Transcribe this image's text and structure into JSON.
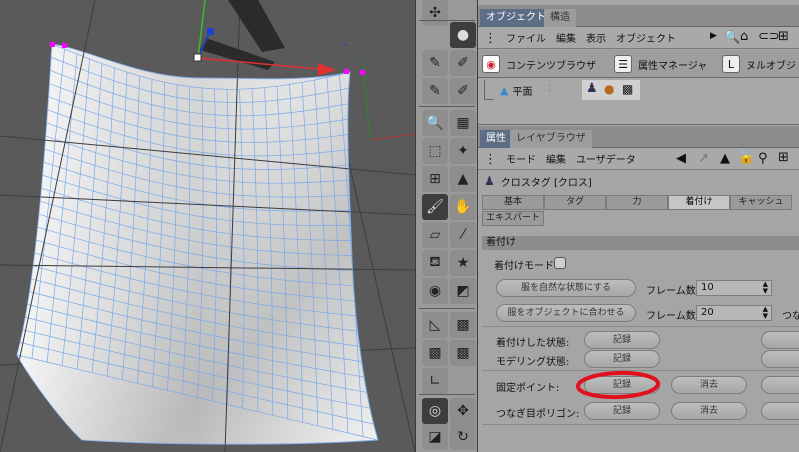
{
  "object_manager": {
    "tabs": [
      "オブジェクト",
      "構造"
    ],
    "menus": [
      "ファイル",
      "編集",
      "表示",
      "オブジェクト"
    ],
    "browser_items": [
      "コンテンツブラウザ",
      "属性マネージャ",
      "ヌルオブジ"
    ],
    "object_name": "平面"
  },
  "attribute_manager": {
    "tabs": [
      "属性",
      "レイヤブラウザ"
    ],
    "menus": [
      "モード",
      "編集",
      "ユーザデータ"
    ],
    "tag_title": "クロスタグ [クロス]",
    "subtabs_row1": [
      "基本",
      "タグ",
      "力",
      "着付け",
      "キャッシュ"
    ],
    "subtabs_row2": [
      "エキスパート"
    ],
    "active_subtab": "着付け",
    "section_title": "着付け",
    "dress_mode_label": "着付けモード",
    "relax_button": "服を自然な状態にする",
    "fit_button": "服をオブジェクトに合わせる",
    "frames_label": "フレーム数",
    "frames_value_1": "10",
    "frames_value_2": "20",
    "truncated_label": "つな",
    "rows": [
      {
        "label": "着付けした状態:",
        "set": "記録"
      },
      {
        "label": "モデリング状態:",
        "set": "記録"
      },
      {
        "label": "固定ポイント:",
        "set": "記録",
        "clear": "消去"
      },
      {
        "label": "つなぎ目ポリゴン:",
        "set": "記録",
        "clear": "消去"
      }
    ]
  },
  "colors": {
    "tab_active": "#5d6d85",
    "annotation_circle": "#e0101e",
    "mesh_line": "#79a9ea",
    "selected_point": "#ff00ff"
  }
}
